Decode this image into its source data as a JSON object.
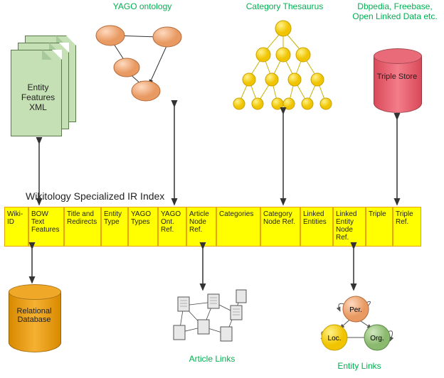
{
  "top_labels": {
    "yago": "YAGO ontology",
    "thesaurus": "Category Thesaurus",
    "dblinks": "Dbpedia, Freebase, Open Linked Data etc."
  },
  "doc_label": "Entity Features XML",
  "triple_store_label": "Triple Store",
  "index_title": "Wikitology Specialized IR Index",
  "index_cells": [
    "Wiki-ID",
    "BOW Text Features",
    "Title and Redirects",
    "Entity Type",
    "YAGO Types",
    "YAGO Ont. Ref.",
    "Article Node Ref.",
    "Categories",
    "Category Node Ref.",
    "Linked Entities",
    "Linked Entity Node Ref.",
    "Triple",
    "Triple Ref."
  ],
  "rel_db_label": "Relational Database",
  "bottom_labels": {
    "article_links": "Article Links",
    "entity_links": "Entity Links"
  },
  "entity_nodes": {
    "per": "Per.",
    "loc": "Loc.",
    "org": "Org."
  },
  "colors": {
    "green_text": "#00b050",
    "yellow": "#ffff00",
    "orange": "#f4a826",
    "peach": "#f4b183",
    "thes_yellow": "#ffe040",
    "red": "#e96a78",
    "doc_green": "#c5e0b4",
    "loc_node": "#ffe040",
    "per_node": "#f4b183",
    "org_node": "#a9d18e"
  }
}
